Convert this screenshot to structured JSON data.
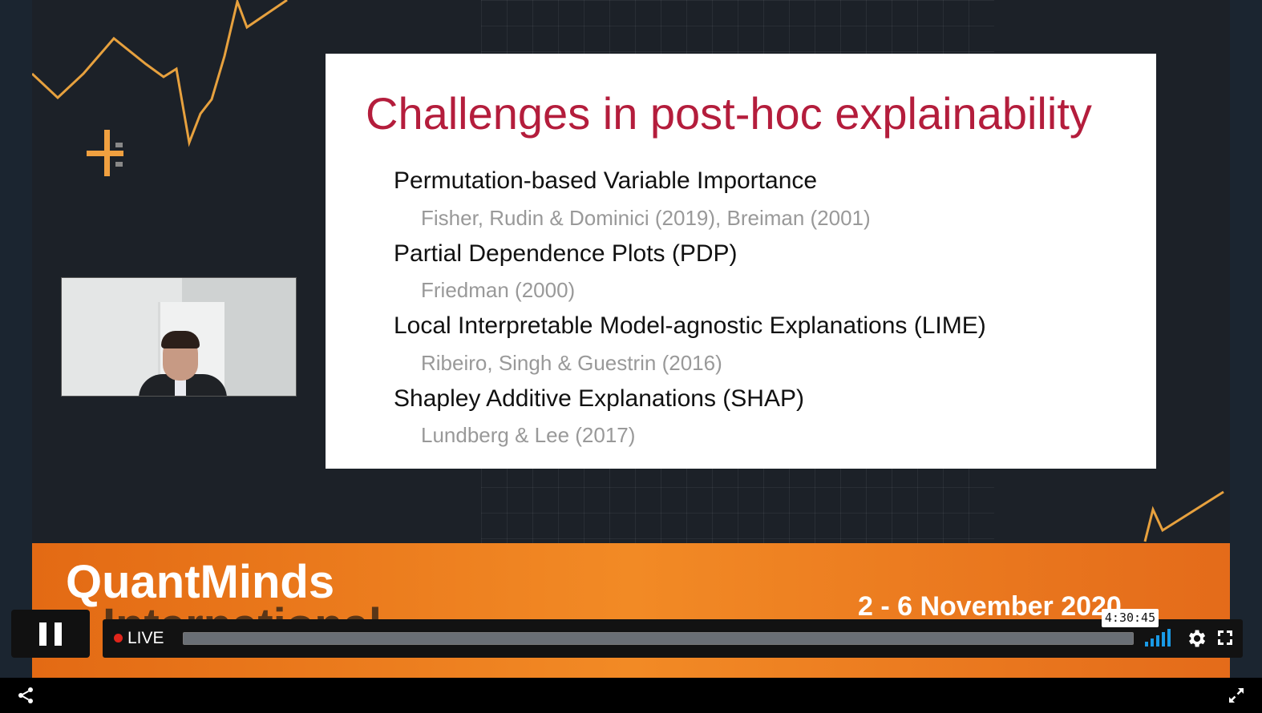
{
  "slide": {
    "title": "Challenges in post-hoc explainability",
    "items": [
      {
        "method": "Permutation-based Variable Importance",
        "reference": "Fisher, Rudin & Dominici (2019), Breiman (2001)"
      },
      {
        "method": "Partial Dependence Plots (PDP)",
        "reference": "Friedman (2000)"
      },
      {
        "method": "Local Interpretable Model-agnostic Explanations (LIME)",
        "reference": "Ribeiro, Singh & Guestrin (2016)"
      },
      {
        "method": "Shapley Additive Explanations (SHAP)",
        "reference": "Lundberg & Lee (2017)"
      }
    ]
  },
  "banner": {
    "brand_line1": "QuantMinds",
    "brand_line2": "International",
    "dates": "2 - 6 November 2020"
  },
  "player": {
    "live_label": "LIVE",
    "time_tooltip": "4:30:45",
    "progress_fraction": 1.0
  },
  "icons": {
    "pause": "pause-icon",
    "signal": "signal-strength-icon",
    "settings": "gear-icon",
    "fullscreen": "fullscreen-icon",
    "share": "share-icon",
    "expand": "expand-icon"
  },
  "colors": {
    "slide_title": "#b41d3c",
    "banner": "#f28a25",
    "accent_line": "#e7a13e",
    "live_dot": "#e0251b",
    "signal": "#1a9ae6"
  }
}
